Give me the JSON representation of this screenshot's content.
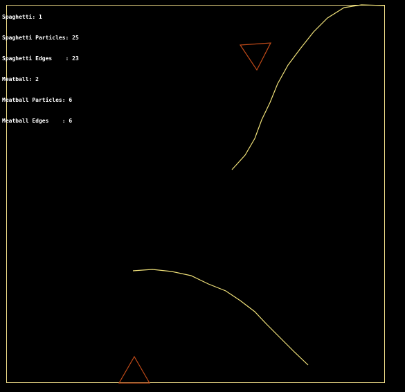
{
  "hud": {
    "lines": [
      "Spaghetti: 1",
      "Spaghetti Particles: 25",
      "Spaghetti Edges    : 23",
      "Meatball: 2",
      "Meatball Particles: 6",
      "Meatball Edges    : 6"
    ]
  },
  "colors": {
    "background": "#000000",
    "boundary": "#f3e08a",
    "spaghetti": "#f1e27a",
    "meatball": "#c04a18",
    "hud_text": "#ffffff"
  }
}
